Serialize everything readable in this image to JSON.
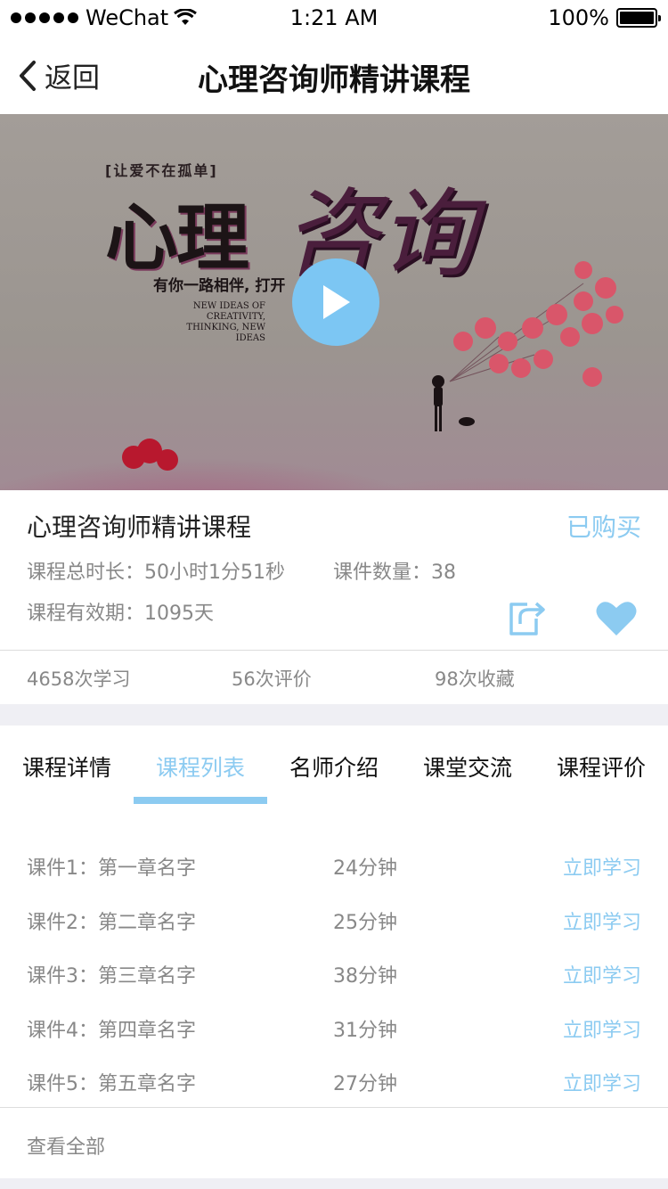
{
  "status_bar": {
    "carrier": "WeChat",
    "time": "1:21 AM",
    "battery": "100%"
  },
  "nav": {
    "back_label": "返回",
    "title": "心理咨询师精讲课程"
  },
  "banner": {
    "tagline": "[让爱不在孤单]",
    "big1": "心理",
    "big2": "咨询",
    "sub": "有你一路相伴, 打开",
    "en": "NEW IDEAS OF CREATIVITY, THINKING, NEW IDEAS"
  },
  "course": {
    "title": "心理咨询师精讲课程",
    "status": "已购买",
    "duration": "课程总时长：50小时1分51秒",
    "count": "课件数量：38",
    "validity": "课程有效期：1095天"
  },
  "stats": {
    "studies": "4658次学习",
    "reviews": "56次评价",
    "favorites": "98次收藏"
  },
  "tabs": [
    {
      "label": "课程详情"
    },
    {
      "label": "课程列表"
    },
    {
      "label": "名师介绍"
    },
    {
      "label": "课堂交流"
    },
    {
      "label": "课程评价"
    }
  ],
  "lessons": [
    {
      "name": "课件1：第一章名字",
      "duration": "24分钟",
      "action": "立即学习"
    },
    {
      "name": "课件2：第二章名字",
      "duration": "25分钟",
      "action": "立即学习"
    },
    {
      "name": "课件3：第三章名字",
      "duration": "38分钟",
      "action": "立即学习"
    },
    {
      "name": "课件4：第四章名字",
      "duration": "31分钟",
      "action": "立即学习"
    },
    {
      "name": "课件5：第五章名字",
      "duration": "27分钟",
      "action": "立即学习"
    }
  ],
  "view_all": "查看全部",
  "colors": {
    "accent": "#8ccbf1",
    "play": "#7cc6f3",
    "muted": "#888888"
  }
}
